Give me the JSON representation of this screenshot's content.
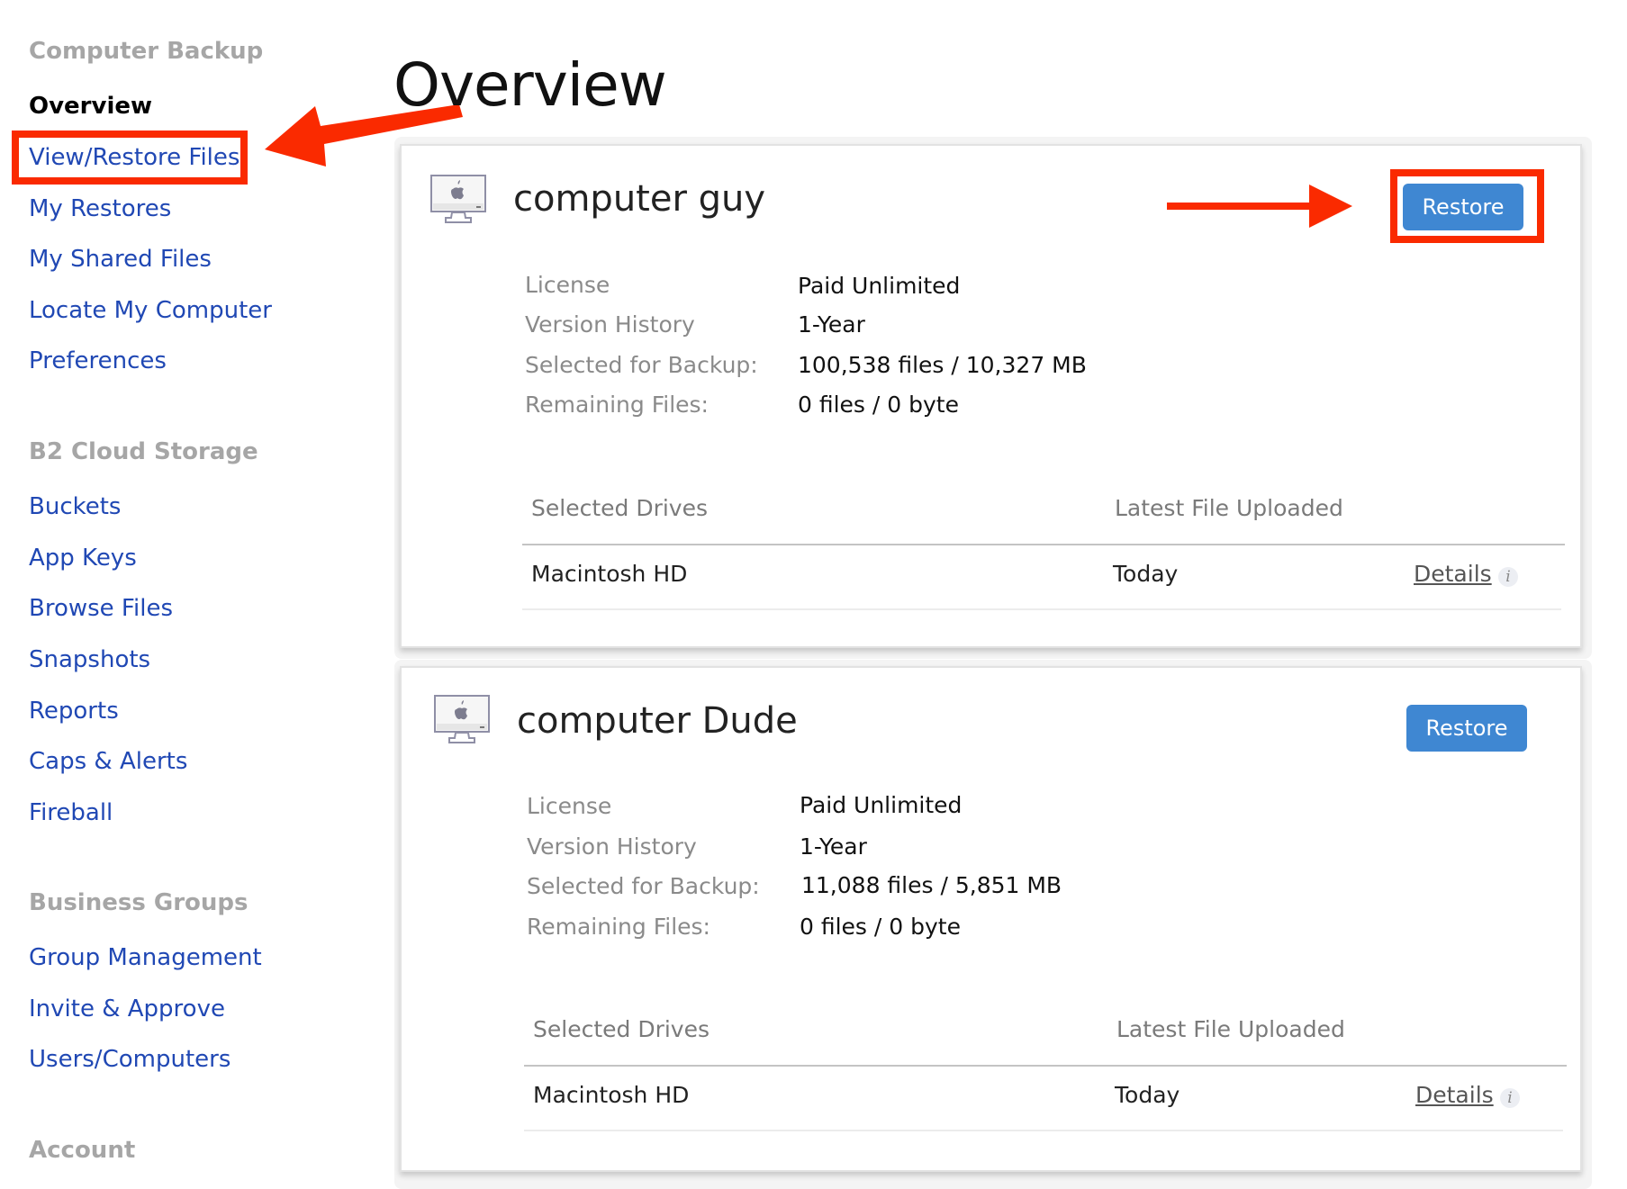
{
  "page": {
    "title": "Overview"
  },
  "sidebar": {
    "sections": [
      {
        "heading": "Computer Backup",
        "items": [
          "Overview",
          "View/Restore Files",
          "My Restores",
          "My Shared Files",
          "Locate My Computer",
          "Preferences"
        ]
      },
      {
        "heading": "B2 Cloud Storage",
        "items": [
          "Buckets",
          "App Keys",
          "Browse Files",
          "Snapshots",
          "Reports",
          "Caps & Alerts",
          "Fireball"
        ]
      },
      {
        "heading": "Business Groups",
        "items": [
          "Group Management",
          "Invite & Approve",
          "Users/Computers"
        ]
      },
      {
        "heading": "Account",
        "items": []
      }
    ],
    "active_item": "Overview",
    "highlighted_item": "View/Restore Files"
  },
  "computers": [
    {
      "name": "computer guy",
      "restore_label": "Restore",
      "restore_highlighted": true,
      "info": [
        {
          "label": "License",
          "value": "Paid Unlimited"
        },
        {
          "label": "Version History",
          "value": "1-Year"
        },
        {
          "label": "Selected for Backup:",
          "value": "100,538 files / 10,327 MB"
        },
        {
          "label": "Remaining Files:",
          "value": "0 files / 0 byte"
        }
      ],
      "table": {
        "headers": [
          "Selected Drives",
          "Latest File Uploaded"
        ],
        "rows": [
          {
            "drive": "Macintosh HD",
            "latest": "Today",
            "link": "Details"
          }
        ]
      }
    },
    {
      "name": "computer Dude",
      "restore_label": "Restore",
      "restore_highlighted": false,
      "info": [
        {
          "label": "License",
          "value": "Paid Unlimited"
        },
        {
          "label": "Version History",
          "value": "1-Year"
        },
        {
          "label": "Selected for Backup:",
          "value": "11,088 files / 5,851 MB"
        },
        {
          "label": "Remaining Files:",
          "value": "0 files / 0 byte"
        }
      ],
      "table": {
        "headers": [
          "Selected Drives",
          "Latest File Uploaded"
        ],
        "rows": [
          {
            "drive": "Macintosh HD",
            "latest": "Today",
            "link": "Details"
          }
        ]
      }
    }
  ],
  "icons": {
    "computer": "imac-icon",
    "info": "info-icon",
    "annotation_arrow": "red-arrow"
  },
  "colors": {
    "link": "#2048b4",
    "accent_button": "#3f87d2",
    "annotation": "#fa2a00",
    "heading_gray": "#a6a6a6"
  }
}
